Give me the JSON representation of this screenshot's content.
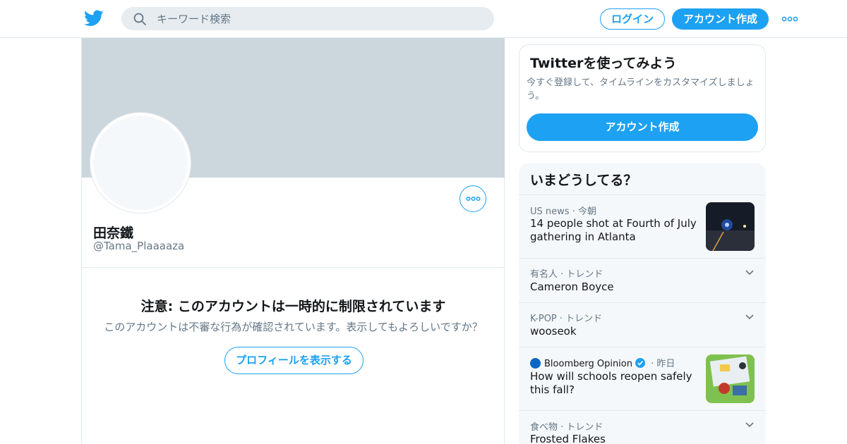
{
  "header": {
    "search_placeholder": "キーワード検索",
    "login_label": "ログイン",
    "signup_label": "アカウント作成"
  },
  "profile": {
    "display_name": "田奈鐵",
    "handle": "@Tama_Plaaaaza",
    "warning_title": "注意: このアカウントは一時的に制限されています",
    "warning_text": "このアカウントは不審な行為が確認されています。表示してもよろしいですか？",
    "show_profile_label": "プロフィールを表示する"
  },
  "signup_card": {
    "title": "Twitterを使ってみよう",
    "description": "今すぐ登録して、タイムラインをカスタマイズしましょう。",
    "button_label": "アカウント作成"
  },
  "trends": {
    "title": "いまどうしてる？",
    "items": [
      {
        "meta": "US news · 今朝",
        "headline": "14 people shot at Fourth of July gathering in Atlanta",
        "has_image": true
      },
      {
        "meta": "有名人 · トレンド",
        "headline": "Cameron Boyce",
        "has_image": false
      },
      {
        "meta": "K-POP · トレンド",
        "headline": "wooseok",
        "has_image": false
      },
      {
        "source": "Bloomberg Opinion",
        "time": "· 昨日",
        "headline": "How will schools reopen safely this fall?",
        "has_image": true
      },
      {
        "meta": "食べ物 · トレンド",
        "headline": "Frosted Flakes",
        "has_image": false
      }
    ]
  },
  "colors": {
    "accent": "#1da1f2",
    "banner": "#ccd6dd",
    "secondary_text": "#657786",
    "trend_bg": "#f5f8fa"
  }
}
